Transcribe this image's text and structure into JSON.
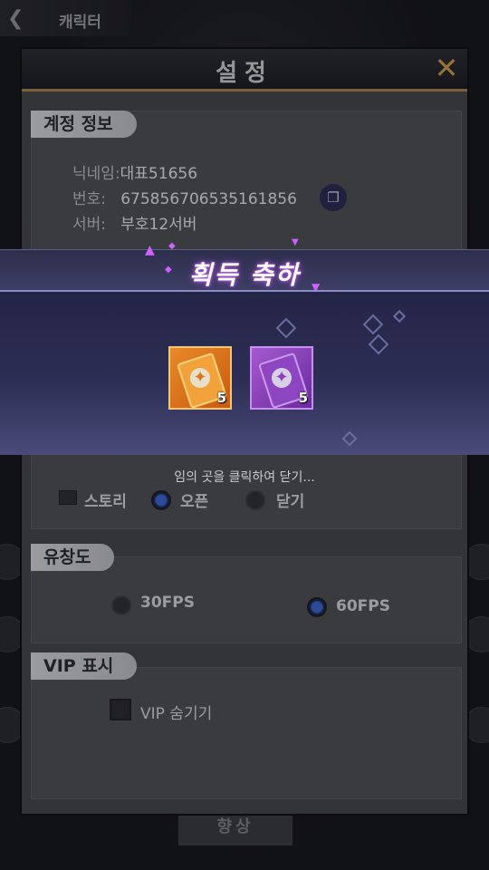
{
  "background": {
    "top_bar_title": "캐릭터",
    "bottom_button": "향상"
  },
  "dialog": {
    "title": "설정",
    "account": {
      "section_title": "계정 정보",
      "nickname_label": "닉네임:",
      "nickname_value": "대표51656",
      "number_label": "번호:",
      "number_value": "675856706535161856",
      "server_label": "서버:",
      "server_value": "부호12서버"
    },
    "story": {
      "label": "스토리",
      "options": [
        "오픈",
        "닫기"
      ],
      "selected": "오픈"
    },
    "fluency": {
      "section_title": "유창도",
      "options": [
        "30FPS",
        "60FPS"
      ],
      "selected": "60FPS"
    },
    "vip": {
      "section_title": "VIP 표시",
      "checkbox_label": "VIP 숨기기",
      "checked": false
    }
  },
  "reward_popup": {
    "title": "획득 축하",
    "items": [
      {
        "type": "orange-card",
        "count": "5"
      },
      {
        "type": "purple-card",
        "count": "5"
      }
    ],
    "close_hint": "임의 곳을 클릭하여 닫기..."
  },
  "colors": {
    "accent_gold": "#c99a48",
    "radio_on": "#3d63c8",
    "title_glow": "#a54bd8"
  }
}
